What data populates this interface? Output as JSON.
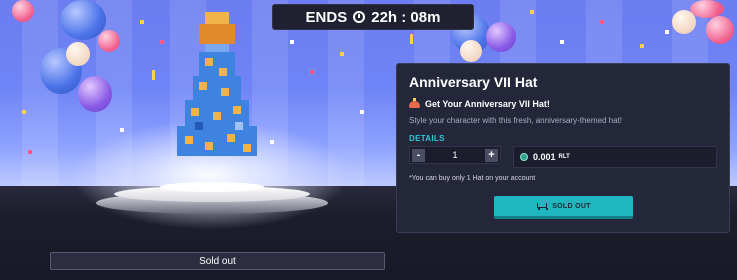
{
  "countdown": {
    "prefix": "ENDS",
    "time": "22h : 08m",
    "icon": "clock-icon"
  },
  "item_panel": {
    "title": "Anniversary VII Hat",
    "subtitle": "Get Your Anniversary VII Hat!",
    "subtitle_icon": "party-hat-icon",
    "description": "Style your character with this fresh, anniversary-themed hat!",
    "details_label": "DETAILS",
    "quantity": {
      "value": "1",
      "minus": "-",
      "plus": "+"
    },
    "price": {
      "amount": "0.001",
      "unit": "RLT",
      "icon": "rlt-coin-icon"
    },
    "limit_note": "*You can buy only 1 Hat on your account",
    "buy_button": {
      "label": "SOLD OUT",
      "icon": "cart-icon"
    }
  },
  "status_bar": {
    "label": "Sold out"
  },
  "colors": {
    "accent": "#1fb6bf",
    "details": "#2ec6d2",
    "panel_bg": "#24263a",
    "hat_blue": "#3f83e0",
    "hat_orange": "#e89a38"
  }
}
